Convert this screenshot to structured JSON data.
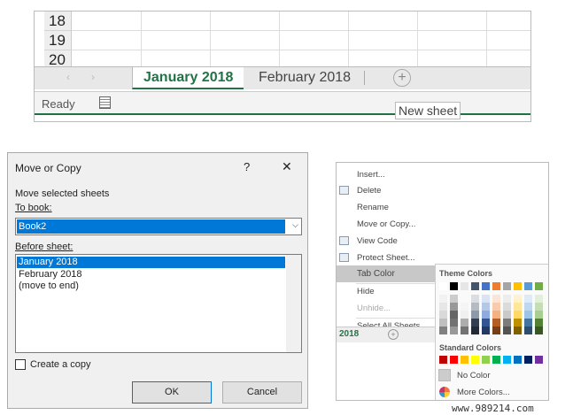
{
  "excel": {
    "rows": [
      "18",
      "19",
      "20"
    ],
    "tabs": [
      "January 2018",
      "February 2018"
    ],
    "status": "Ready",
    "tooltip": "New sheet",
    "accent": "#217346"
  },
  "dialog": {
    "title": "Move or Copy",
    "help": "?",
    "close": "✕",
    "move_label": "Move selected sheets",
    "to_book_label": "To book:",
    "to_book_value": "Book2",
    "before_label": "Before sheet:",
    "sheets": [
      "January 2018",
      "February 2018",
      "(move to end)"
    ],
    "selected_sheet": 0,
    "copy_label": "Create a copy",
    "copy_checked": false,
    "ok": "OK",
    "cancel": "Cancel",
    "selection_color": "#0078d7"
  },
  "context_menu": {
    "items": [
      "Insert...",
      "Delete",
      "Rename",
      "Move or Copy...",
      "View Code",
      "Protect Sheet...",
      "Tab Color",
      "Hide",
      "Unhide...",
      "Select All Sheets"
    ],
    "highlighted": "Tab Color",
    "disabled": [
      "Unhide..."
    ],
    "tab_label": "2018",
    "submenu": {
      "theme_title": "Theme Colors",
      "theme_colors": [
        "#ffffff",
        "#000000",
        "#e7e6e6",
        "#44546a",
        "#4472c4",
        "#ed7d31",
        "#a5a5a5",
        "#ffc000",
        "#5b9bd5",
        "#70ad47"
      ],
      "standard_title": "Standard Colors",
      "standard_colors": [
        "#c00000",
        "#ff0000",
        "#ffc000",
        "#ffff00",
        "#92d050",
        "#00b050",
        "#00b0f0",
        "#0070c0",
        "#002060",
        "#7030a0"
      ],
      "no_color": "No Color",
      "more_colors": "More Colors..."
    }
  },
  "watermark": "www.989214.com"
}
